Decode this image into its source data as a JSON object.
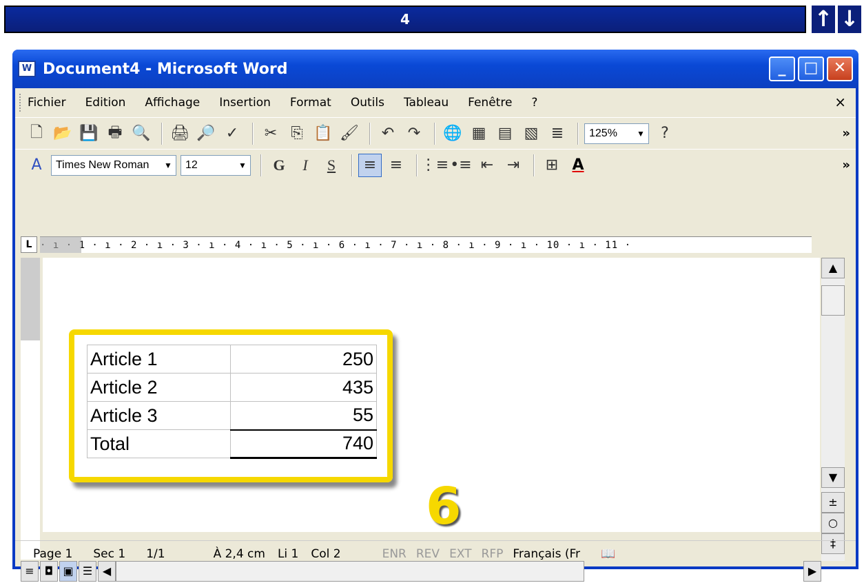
{
  "slide": {
    "number": "4",
    "up": "↑",
    "down": "↓"
  },
  "window": {
    "title": "Document4 - Microsoft Word",
    "app_icon": "W"
  },
  "menu": {
    "items": [
      "Fichier",
      "Edition",
      "Affichage",
      "Insertion",
      "Format",
      "Outils",
      "Tableau",
      "Fenêtre",
      "?"
    ],
    "close": "×"
  },
  "toolbar_standard": {
    "zoom": "125%"
  },
  "toolbar_format": {
    "font": "Times New Roman",
    "size": "12",
    "bold": "G",
    "italic": "I",
    "underline": "S"
  },
  "ruler": {
    "text": "· ı · 1 · ı · 2 · ı · 3 · ı · 4 · ı · 5 · ı · 6 · ı · 7 · ı · 8 · ı · 9 · ı · 10 · ı · 11 ·"
  },
  "table": {
    "rows": [
      {
        "name": "Article 1",
        "value": "250"
      },
      {
        "name": "Article 2",
        "value": "435"
      },
      {
        "name": "Article 3",
        "value": "55"
      },
      {
        "name": "Total",
        "value": "740"
      }
    ]
  },
  "step": "6",
  "status": {
    "page": "Page 1",
    "sec": "Sec 1",
    "pages": "1/1",
    "at": "À 2,4 cm",
    "line": "Li 1",
    "col": "Col 2",
    "enr": "ENR",
    "rev": "REV",
    "ext": "EXT",
    "rfp": "RFP",
    "lang": "Français (Fr"
  }
}
